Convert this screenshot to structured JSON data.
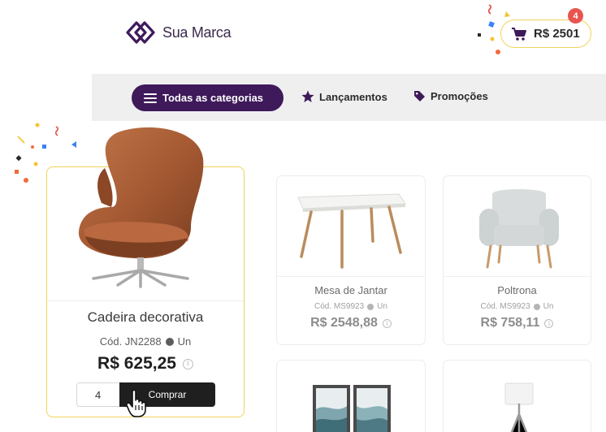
{
  "brand": {
    "name": "Sua Marca",
    "color": "#3e1a5a",
    "accent": "#f1d35c"
  },
  "cart": {
    "total": "R$ 2501",
    "count": "4",
    "icon": "cart-icon"
  },
  "nav": {
    "all_categories": "Todas as categorias",
    "launches": "Lançamentos",
    "promotions": "Promoções"
  },
  "featured": {
    "name": "Cadeira decorativa",
    "code": "Cód. JN2288",
    "unit": "Un",
    "price": "R$ 625,25",
    "info": "i",
    "quantity": "4",
    "buy_label": "Comprar"
  },
  "products": [
    {
      "name": "Mesa de Jantar",
      "code": "Cód. MS9923",
      "unit": "Un",
      "price": "R$ 2548,88",
      "info": "i"
    },
    {
      "name": "Poltrona",
      "code": "Cód. MS9923",
      "unit": "Un",
      "price": "R$ 758,11",
      "info": "i"
    }
  ]
}
